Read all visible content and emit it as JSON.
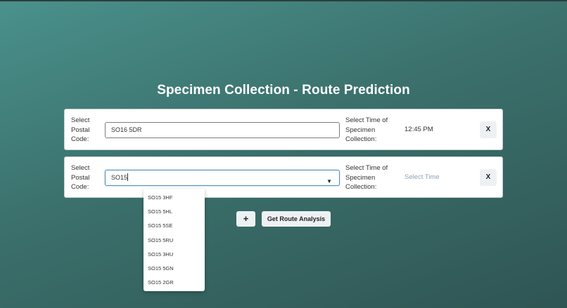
{
  "page": {
    "title": "Specimen Collection - Route Prediction"
  },
  "rows": [
    {
      "postal_label": "Select Postal Code:",
      "postal_value": "SO16 5DR",
      "time_label": "Select Time of Specimen Collection:",
      "time_value": "12:45 PM",
      "remove_label": "X"
    },
    {
      "postal_label": "Select Postal Code:",
      "postal_value": "SO15",
      "time_label": "Select Time of Specimen Collection:",
      "time_placeholder": "Select Time",
      "remove_label": "X",
      "dropdown_arrow": "▼"
    }
  ],
  "suggestions": [
    "SO15 3HF",
    "SO15 5HL",
    "SO15 5SE",
    "SO15 5RU",
    "SO15 3HU",
    "SO15 5GN",
    "SO15 2GR"
  ],
  "actions": {
    "add_label": "+",
    "analysis_label": "Get Route Analysis"
  },
  "colors": {
    "background_start": "#4a918c",
    "background_end": "#2f5553",
    "input_focus": "#4b8fc6",
    "placeholder": "#8fa3b5"
  }
}
